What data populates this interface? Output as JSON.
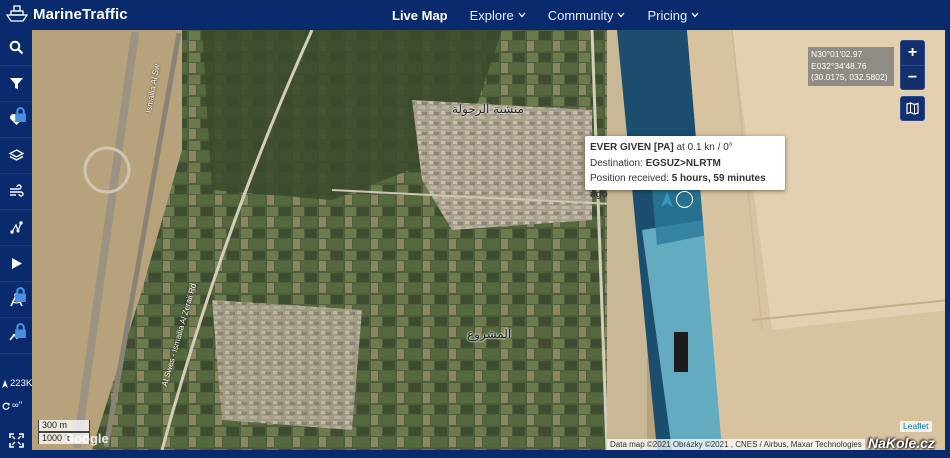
{
  "header": {
    "brand": "MarineTraffic",
    "nav": [
      {
        "label": "Live Map",
        "active": true
      },
      {
        "label": "Explore",
        "active": false
      },
      {
        "label": "Community",
        "active": false
      },
      {
        "label": "Pricing",
        "active": false
      }
    ]
  },
  "sidebar": {
    "tools": [
      {
        "icon": "search-icon",
        "locked": false
      },
      {
        "icon": "filter-icon",
        "locked": false
      },
      {
        "icon": "heart-icon",
        "locked": true
      },
      {
        "icon": "layers-icon",
        "locked": false
      },
      {
        "icon": "wind-icon",
        "locked": false
      },
      {
        "icon": "route-icon",
        "locked": false
      },
      {
        "icon": "play-icon",
        "locked": false
      },
      {
        "icon": "compass-icon",
        "locked": true
      },
      {
        "icon": "chart-line-icon",
        "locked": true
      }
    ],
    "vessel_count": "223K",
    "infinity_label": "∞\""
  },
  "map": {
    "coordinates": {
      "lat": "N30°01'02.97",
      "lon": "E032°34'48.76",
      "decimal": "(30.0175, 032.5802)"
    },
    "zoom_in": "+",
    "zoom_out": "−",
    "popup": {
      "vessel": "EVER GIVEN [PA]",
      "speed_course": "at 0.1 kn / 0°",
      "destination_label": "Destination:",
      "destination": "EGSUZ>NLRTM",
      "position_label": "Position received:",
      "position_time": "5 hours, 59 minutes ago"
    },
    "scale_metric": "300 m",
    "scale_imperial": "1000 ft",
    "google": "Google",
    "attribution": "Data map ©2021 Obrázky ©2021 , CNES / Airbus, Maxar Technologies",
    "leaflet": "Leaflet",
    "watermark": "NaKole.cz",
    "place_labels": [
      "منشية الرحولة",
      "المشروع"
    ],
    "road_labels": [
      "Al Swes - Ismailia Al Zeraii Rd",
      "Ismailia Al Sw"
    ]
  }
}
